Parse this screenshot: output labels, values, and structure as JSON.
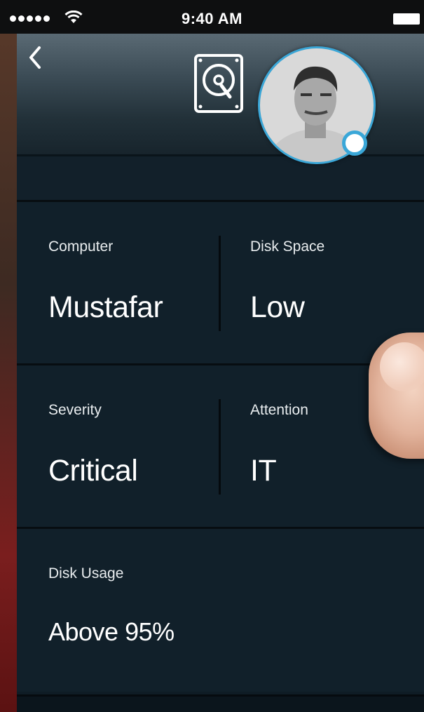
{
  "status_bar": {
    "time": "9:40 AM"
  },
  "header": {
    "back_icon": "chevron-left-icon",
    "center_icon": "hard-drive-icon",
    "avatar": "user-avatar",
    "presence_color": "#3aa7d8"
  },
  "details": {
    "computer": {
      "label": "Computer",
      "value": "Mustafar"
    },
    "disk_space": {
      "label": "Disk Space",
      "value": "Low"
    },
    "severity": {
      "label": "Severity",
      "value": "Critical"
    },
    "attention": {
      "label": "Attention",
      "value": "IT"
    },
    "disk_usage": {
      "label": "Disk Usage",
      "value": "Above 95%"
    }
  },
  "colors": {
    "panel_bg": "#11202a",
    "accent": "#3aa7d8",
    "text": "#ffffff"
  }
}
